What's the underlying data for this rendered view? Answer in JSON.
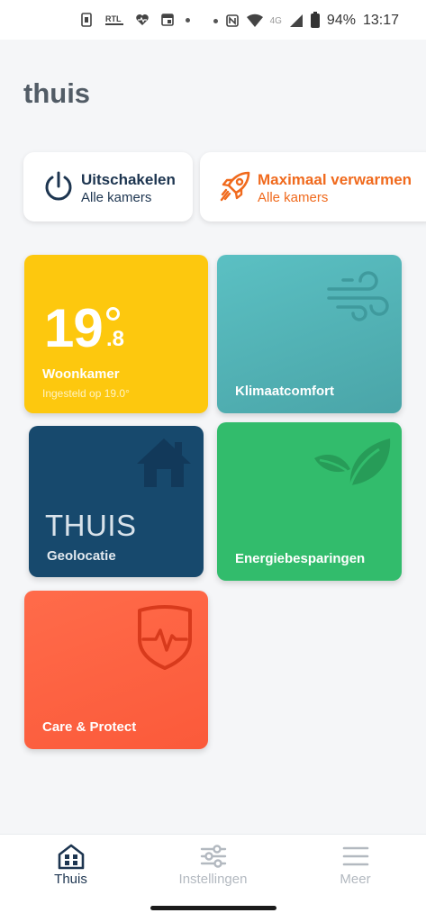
{
  "status_bar": {
    "battery_percent": "94%",
    "time": "13:17",
    "network": "4G",
    "left_icons": [
      "sim-icon",
      "rtl-news-icon",
      "heart-icon",
      "calendar-icon",
      "dot-icon"
    ],
    "right_icons": [
      "dot-icon",
      "nfc-icon",
      "wifi-icon",
      "signal-icon",
      "battery-icon"
    ]
  },
  "page": {
    "title": "thuis"
  },
  "quick_actions": [
    {
      "title": "Uitschakelen",
      "subtitle": "Alle kamers",
      "icon": "power-icon",
      "color": "#1d3550"
    },
    {
      "title": "Maximaal verwarmen",
      "subtitle": "Alle kamers",
      "icon": "rocket-icon",
      "color": "#f06a1d"
    }
  ],
  "tiles": {
    "woonkamer": {
      "temp_main": "19",
      "temp_decimal": ".8",
      "label": "Woonkamer",
      "sub": "Ingesteld op 19.0°",
      "color": "#fdc80e"
    },
    "klimaat": {
      "label": "Klimaatcomfort",
      "icon": "wind-icon",
      "color": "#52b3b6"
    },
    "thuis": {
      "big": "THUIS",
      "label": "Geolocatie",
      "icon": "house-icon",
      "color": "#17496d"
    },
    "energie": {
      "label": "Energiebesparingen",
      "icon": "leaves-icon",
      "color": "#32bc6c"
    },
    "care": {
      "label": "Care & Protect",
      "icon": "shield-heartbeat-icon",
      "color": "#fb5a3a"
    }
  },
  "bottom_nav": [
    {
      "label": "Thuis",
      "icon": "home-grid-icon",
      "active": true
    },
    {
      "label": "Instellingen",
      "icon": "sliders-icon",
      "active": false
    },
    {
      "label": "Meer",
      "icon": "menu-icon",
      "active": false
    }
  ]
}
